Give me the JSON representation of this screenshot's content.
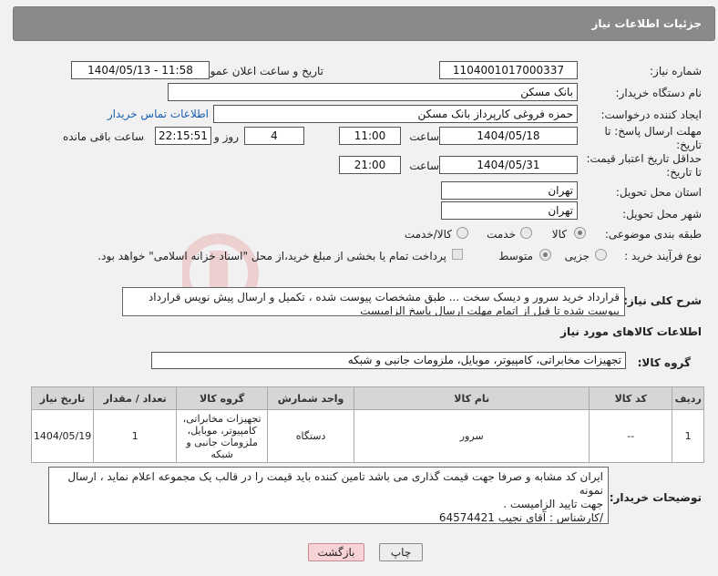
{
  "header": {
    "title": "جزئیات اطلاعات نیاز"
  },
  "fields": {
    "need_number_label": "شماره نیاز:",
    "need_number": "1104001017000337",
    "announce_label": "تاریخ و ساعت اعلان عمومی:",
    "announce_value": "1404/05/13 - 11:58",
    "buyer_org_label": "نام دستگاه خریدار:",
    "buyer_org": "بانک مسکن",
    "creator_label": "ایجاد کننده درخواست:",
    "creator": "حمزه فروغی کارپرداز بانک مسکن",
    "contact_link": "اطلاعات تماس خریدار",
    "deadline_label_1": "مهلت ارسال پاسخ: تا",
    "deadline_label_2": "تاریخ:",
    "deadline_date": "1404/05/18",
    "time_label": "ساعت",
    "deadline_time": "11:00",
    "days_value": "4",
    "days_label": "روز و",
    "remaining_time": "22:15:51",
    "remaining_label": "ساعت باقی مانده",
    "validity_label_1": "حداقل تاریخ اعتبار قیمت:",
    "validity_label_2": "تا تاریخ:",
    "validity_date": "1404/05/31",
    "validity_time_label": "ساعت",
    "validity_time": "21:00",
    "province_label": "استان محل تحویل:",
    "province": "تهران",
    "city_label": "شهر محل تحویل:",
    "city": "تهران",
    "category_label": "طبقه بندی موضوعی:",
    "category_options": [
      "کالا",
      "خدمت",
      "کالا/خدمت"
    ],
    "category_selected": "کالا",
    "process_label": "نوع فرآیند خرید :",
    "process_options": [
      "جزیی",
      "متوسط"
    ],
    "process_selected": "متوسط",
    "payment_note": "پرداخت تمام یا بخشی از مبلغ خرید،از محل \"اسناد خزانه اسلامی\" خواهد بود."
  },
  "description": {
    "label": "شرح کلی نیاز:",
    "text": "قرارداد خرید سرور و دیسک سخت ...   طبق مشخصات پیوست شده ، تکمیل و ارسال پیش نویس قرارداد پیوست شده تا قبل از اتمام مهلت ارسال پاسخ الزامیست"
  },
  "goods": {
    "section_title": "اطلاعات کالاهای مورد نیاز",
    "group_label": "گروه کالا:",
    "group_value": "تجهیزات مخابراتی، کامپیوتر، موبایل، ملزومات جانبی و شبکه",
    "columns": [
      "ردیف",
      "کد کالا",
      "نام کالا",
      "واحد شمارش",
      "گروه کالا",
      "تعداد / مقدار",
      "تاریخ نیاز"
    ],
    "rows": [
      {
        "index": "1",
        "code": "--",
        "name": "سرور",
        "unit": "دستگاه",
        "group": "تجهیزات مخابراتی، کامپیوتر، موبایل، ملزومات جانبی و شبکه",
        "qty": "1",
        "date": "1404/05/19"
      }
    ]
  },
  "buyer_notes": {
    "label": "توضیحات خریدار:",
    "text_line1": "ایران کد مشابه و صرفا جهت قیمت گذاری می باشد تامین کننده باید قیمت را در قالب یک مجموعه اعلام نماید ، ارسال نمونه",
    "text_line2": "جهت تایید الزامیست .",
    "text_line3": "/کارشناس : آقای نجیب 64574421"
  },
  "buttons": {
    "print": "چاپ",
    "back": "بازگشت"
  },
  "colors": {
    "header_bg": "#8a8a8a",
    "link": "#1a5fb4",
    "back_button": "#f7d3d8"
  }
}
